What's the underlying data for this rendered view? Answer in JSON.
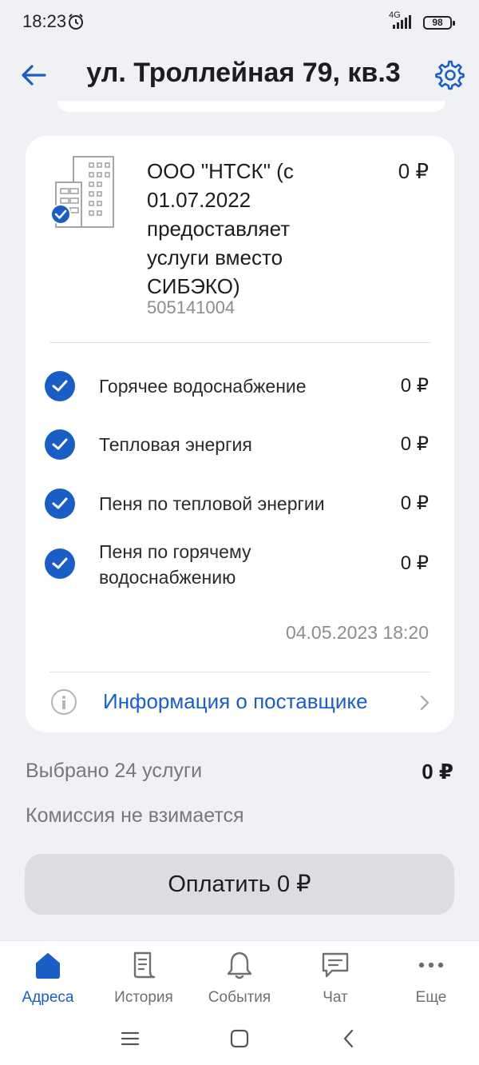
{
  "status": {
    "time": "18:23",
    "network": "4G",
    "battery": "98"
  },
  "header": {
    "title": "ул. Троллейная 79, кв.3"
  },
  "provider": {
    "name": "ООО \"НТСК\" (с 01.07.2022 предоставляет услуги вместо СИБЭКО)",
    "amount": "0 ₽",
    "account": "505141004"
  },
  "services": [
    {
      "label": "Горячее водоснабжение",
      "amount": "0 ₽"
    },
    {
      "label": "Тепловая энергия",
      "amount": "0 ₽"
    },
    {
      "label": "Пеня по тепловой энергии",
      "amount": "0 ₽"
    },
    {
      "label": "Пеня по горячему водоснабжению",
      "amount": "0 ₽"
    }
  ],
  "timestamp": "04.05.2023 18:20",
  "info_link": "Информация о поставщике",
  "summary": {
    "selected": "Выбрано 24 услуги",
    "total": "0 ₽",
    "commission": "Комиссия не взимается"
  },
  "pay_button": "Оплатить 0 ₽",
  "nav": [
    {
      "label": "Адреса",
      "icon": "home-icon"
    },
    {
      "label": "История",
      "icon": "receipt-icon"
    },
    {
      "label": "События",
      "icon": "bell-icon"
    },
    {
      "label": "Чат",
      "icon": "chat-icon"
    },
    {
      "label": "Еще",
      "icon": "more-icon"
    }
  ],
  "colors": {
    "accent": "#1a5dc5",
    "background": "#f0f1f5",
    "card": "#ffffff"
  }
}
